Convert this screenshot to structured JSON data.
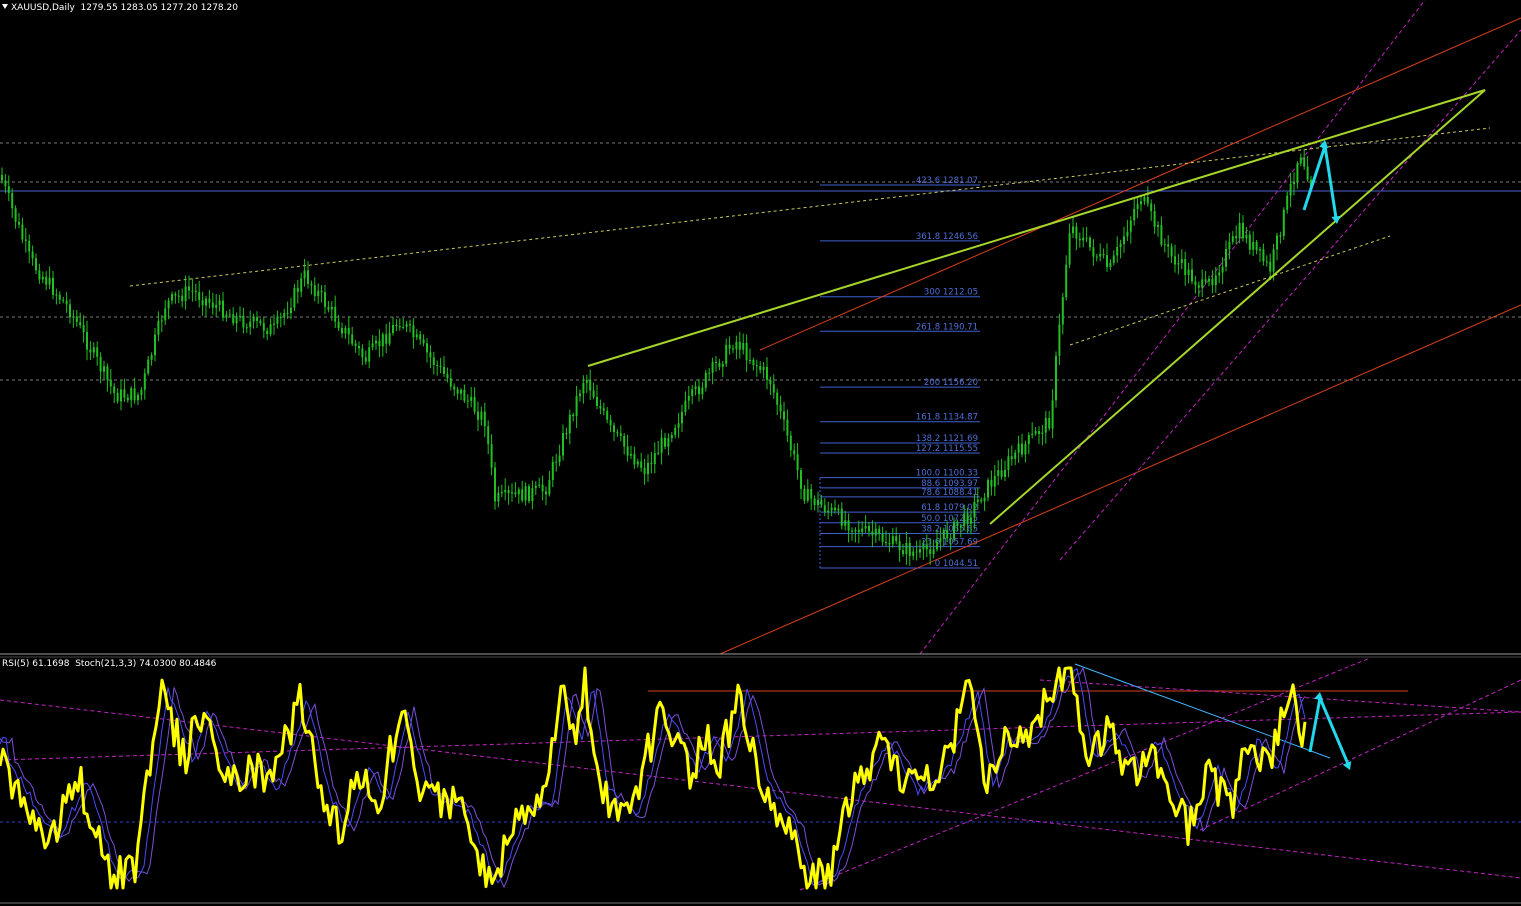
{
  "header": {
    "symbol": "XAUUSD,Daily",
    "ohlc": "1279.55 1283.05 1277.20 1278.20"
  },
  "indicator_header": {
    "rsi": "RSI(5) 61.1698",
    "stoch": "Stoch(21,3,3) 74.0300 80.4846"
  },
  "colors": {
    "background": "#000000",
    "candles": "#22c022",
    "fib": "#3f5fcf",
    "fib_label": "#4f6fd6",
    "trend_wedge": "#a6d62a",
    "channel_red": "#d8401c",
    "channel_magenta": "#c023c0",
    "forecast_arrow": "#22d8ea",
    "rsi": "#ffff00",
    "stoch": "#5050ff"
  },
  "icons": {
    "collapse": "triangle-down-icon"
  },
  "chart_data": [
    {
      "type": "candlestick",
      "title": "XAUUSD,Daily",
      "ohlc_last": {
        "open": 1279.55,
        "high": 1283.05,
        "low": 1277.2,
        "close": 1278.2
      },
      "ylim": [
        1000,
        1315
      ],
      "fibonacci": [
        {
          "level": "423.6",
          "price": "1281.07"
        },
        {
          "level": "361.8",
          "price": "1246.56"
        },
        {
          "level": "300",
          "price": "1212.05"
        },
        {
          "level": "261.8",
          "price": "1190.71"
        },
        {
          "level": "200",
          "price": "1156.20"
        },
        {
          "level": "161.8",
          "price": "1134.87"
        },
        {
          "level": "138.2",
          "price": "1121.69"
        },
        {
          "level": "127.2",
          "price": "1115.55"
        },
        {
          "level": "100.0",
          "price": "1100.33"
        },
        {
          "level": "88.6",
          "price": "1093.97"
        },
        {
          "level": "78.6",
          "price": "1088.41"
        },
        {
          "level": "61.8",
          "price": "1079.02"
        },
        {
          "level": "50.0",
          "price": "1072.45"
        },
        {
          "level": "38.2",
          "price": "1065.85"
        },
        {
          "level": "23.6",
          "price": "1057.69"
        },
        {
          "level": "0",
          "price": "1044.51"
        }
      ],
      "grid": false
    },
    {
      "type": "line",
      "title": "",
      "series": [
        {
          "name": "RSI(5)",
          "last": 61.1698
        },
        {
          "name": "Stoch(21,3,3)",
          "main": 74.03,
          "signal": 80.4846
        }
      ],
      "ylim": [
        0,
        100
      ]
    }
  ]
}
